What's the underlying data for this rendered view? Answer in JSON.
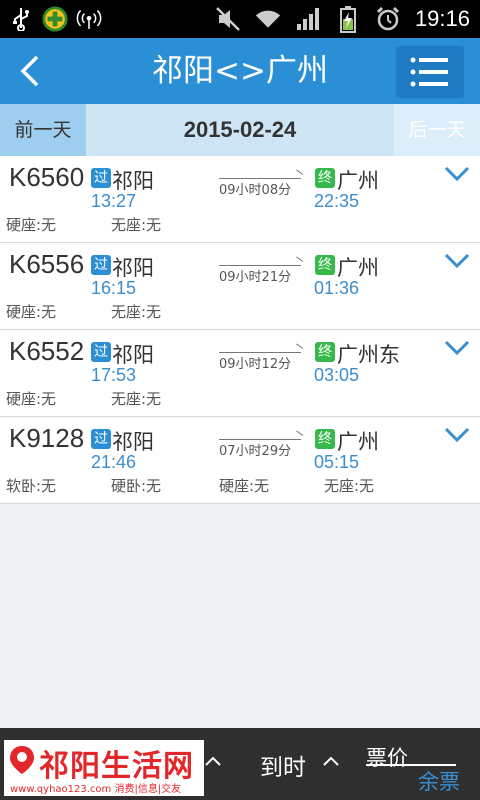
{
  "status_bar": {
    "time": "19:16",
    "icons": [
      "usb-icon",
      "360-security-icon",
      "wifi-signal-icon",
      "mute-icon",
      "wifi-icon",
      "cell-signal-icon",
      "battery-charging-icon",
      "alarm-icon"
    ]
  },
  "header": {
    "title": "祁阳<>广州",
    "back_icon": "back-arrow-icon",
    "menu_icon": "menu-icon"
  },
  "date_bar": {
    "prev_label": "前一天",
    "date": "2015-02-24",
    "next_label": "后一天"
  },
  "trains": [
    {
      "number": "K6560",
      "from_badge": "过",
      "from_station": "祁阳",
      "depart": "13:27",
      "duration": "09小时08分",
      "to_badge": "终",
      "to_station": "广州",
      "arrive": "22:35",
      "seats": [
        "硬座:无",
        "无座:无"
      ]
    },
    {
      "number": "K6556",
      "from_badge": "过",
      "from_station": "祁阳",
      "depart": "16:15",
      "duration": "09小时21分",
      "to_badge": "终",
      "to_station": "广州",
      "arrive": "01:36",
      "seats": [
        "硬座:无",
        "无座:无"
      ]
    },
    {
      "number": "K6552",
      "from_badge": "过",
      "from_station": "祁阳",
      "depart": "17:53",
      "duration": "09小时12分",
      "to_badge": "终",
      "to_station": "广州东",
      "arrive": "03:05",
      "seats": [
        "硬座:无",
        "无座:无"
      ]
    },
    {
      "number": "K9128",
      "from_badge": "过",
      "from_station": "祁阳",
      "depart": "21:46",
      "duration": "07小时29分",
      "to_badge": "终",
      "to_station": "广州",
      "arrive": "05:15",
      "seats": [
        "软卧:无",
        "硬卧:无",
        "硬座:无",
        "无座:无"
      ]
    }
  ],
  "bottom_bar": {
    "logo_text": "祁阳生活网",
    "logo_sub": "www.qyhao123.com 消费|信息|交友",
    "sort_arrive_label": "到时",
    "sort_price_label": "票价",
    "remaining_label": "余票"
  },
  "colors": {
    "accent": "#2b8fd6",
    "time_text": "#3a8ed0",
    "end_badge": "#36b84a",
    "logo_red": "#e3262a"
  }
}
